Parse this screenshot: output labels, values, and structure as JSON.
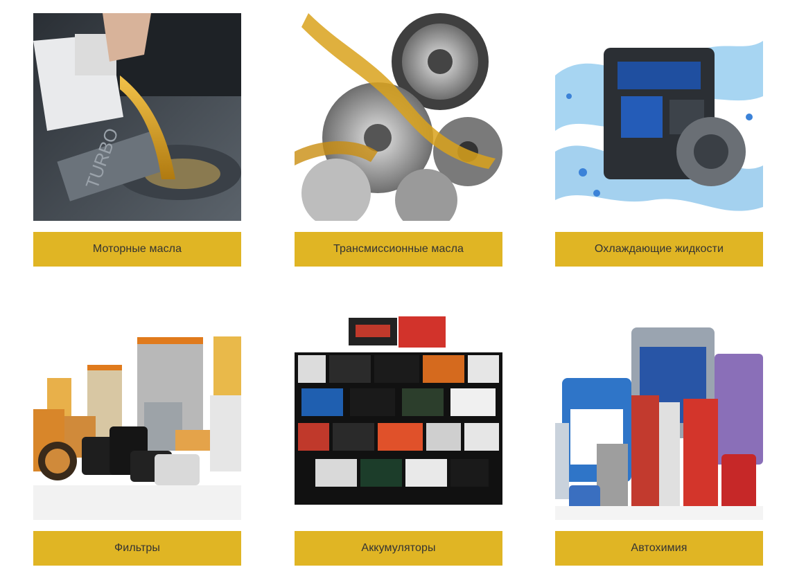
{
  "categories": [
    {
      "label": "Моторные масла",
      "image_icon": "motor-oil-image"
    },
    {
      "label": "Трансмиссионные масла",
      "image_icon": "gear-oil-image"
    },
    {
      "label": "Охлаждающие жидкости",
      "image_icon": "coolant-engine-image"
    },
    {
      "label": "Фильтры",
      "image_icon": "filters-image"
    },
    {
      "label": "Аккумуляторы",
      "image_icon": "batteries-image"
    },
    {
      "label": "Автохимия",
      "image_icon": "auto-chemicals-image"
    }
  ],
  "colors": {
    "button_bg": "#e0b524",
    "button_text": "#333333",
    "page_bg": "#ffffff"
  }
}
